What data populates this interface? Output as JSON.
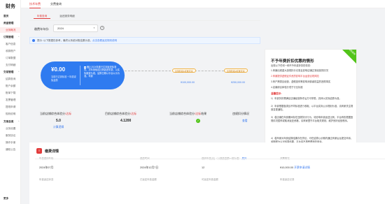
{
  "sidebar": {
    "logo": "财务",
    "items": [
      {
        "label": "首页",
        "type": "head"
      },
      {
        "label": "资金管理",
        "type": "head"
      },
      {
        "label": "业务概况",
        "type": "active"
      },
      {
        "label": "订购管理",
        "type": "head"
      },
      {
        "label": "客户信息",
        "type": "item"
      },
      {
        "label": "收款账户",
        "type": "item"
      },
      {
        "label": "订单数据",
        "type": "item"
      },
      {
        "label": "支付明细",
        "type": "item"
      },
      {
        "label": "交易管理",
        "type": "head"
      },
      {
        "label": "结算查询",
        "type": "item"
      },
      {
        "label": "账户余额",
        "type": "item"
      },
      {
        "label": "账单下载",
        "type": "item"
      },
      {
        "label": "发票管理",
        "type": "item"
      },
      {
        "label": "提现申请",
        "type": "item"
      },
      {
        "label": "规则说明",
        "type": "item"
      },
      {
        "label": "方案总揽",
        "type": "head"
      },
      {
        "label": "业务设置",
        "type": "item"
      },
      {
        "label": "服务协议",
        "type": "item"
      },
      {
        "label": "操作手册",
        "type": "item"
      },
      {
        "label": "通知公告",
        "type": "item"
      },
      {
        "label": "更多",
        "type": "head"
      }
    ]
  },
  "topbar": {
    "tabs": [
      "技术年费",
      "交费查询"
    ]
  },
  "subtabs": [
    "年费查询",
    "返还服务明细"
  ],
  "filter": {
    "year_label": "缴费年年份:",
    "year_value": "2024",
    "help": "?"
  },
  "notice": {
    "text": "提示: 以下数据仅参考，最终以系统对账结果为准，",
    "link": "点击查看返还规则说明"
  },
  "flow": {
    "amount": "¥0.00",
    "amount_sub": "当前已达到标准 + 年费减免金额",
    "right_text": "截止2024年度已达到返还标准的，次年按相应比例返还年费，以实际缴费为准；结算日期以平台公示为准。年费",
    "steps": [
      {
        "badge": "达到阶段1标准可享",
        "amount": "¥100,000.00"
      },
      {
        "badge": "达到阶段2标准可享",
        "amount": "¥250,000.00"
      }
    ]
  },
  "stats": [
    {
      "label": "当前店铺综合体验分",
      "label_red": "/达标",
      "value": "5.0",
      "link": "计算逻辑"
    },
    {
      "label": "目前店铺综合体验分",
      "label_red": "/达标",
      "value": "4.1200",
      "link": ""
    },
    {
      "label": "当前店铺综合体验分",
      "label_red": "/达标",
      "value_note": "结果",
      "value": "",
      "link": ""
    },
    {
      "label": "违规扣分情况",
      "label_red": "",
      "value": "",
      "link": "查看"
    }
  ],
  "rpanel": {
    "corner": "规则说明",
    "title": "不予年费折扣优惠的情形",
    "lines": [
      "出现以下任何一种不予年费折扣的情形:",
      "1.商铺出现重大违规扣分记录且影响店铺正常经营的情况",
      "2.商铺提供虚假证件资质影响平台运营合规风险",
      "3.商户跨类目经营、虚假宣传等影响消费者权益的违规事实",
      "4.店铺综合体验分低于行业标准"
    ],
    "head2": "温馨提示:",
    "paras": [
      "1）年费折扣需满足店铺经营条件后方可享受，具体以实际结算为准。",
      "2）年费根据各类目不同标准进行收取，以平台实际公示规则为准，请商家关注规则变更通知。",
      "3）若店铺在年费期间存在违规扣分行为，将影响年费返还比例，平台有权根据违规情况暂停或取消返还资格，请商家遵守平台相关规则，维护良好经营秩序。",
      "4）若商家对年费结算结果存在异议，可在结算公示期内通过商家后台提交申诉，逾期视为认可结算结果，平台将不再受理相关申诉。"
    ]
  },
  "detail": {
    "title": "缴费详情",
    "headers": [
      "年费缴纳年份",
      "缴费时间",
      "缴纳年费(元)（以缴费金额一致为准）",
      "开票情况"
    ],
    "row": [
      "2024年07月",
      "2024年12月7日",
      "12",
      "¥10,000.00"
    ],
    "row_links": [
      "查看",
      "开票申请详情"
    ],
    "headers2": [
      "年费返还状态",
      "已返还年费金额",
      "可返还年费金额",
      "年费返还记录"
    ],
    "header_link": "展开"
  }
}
